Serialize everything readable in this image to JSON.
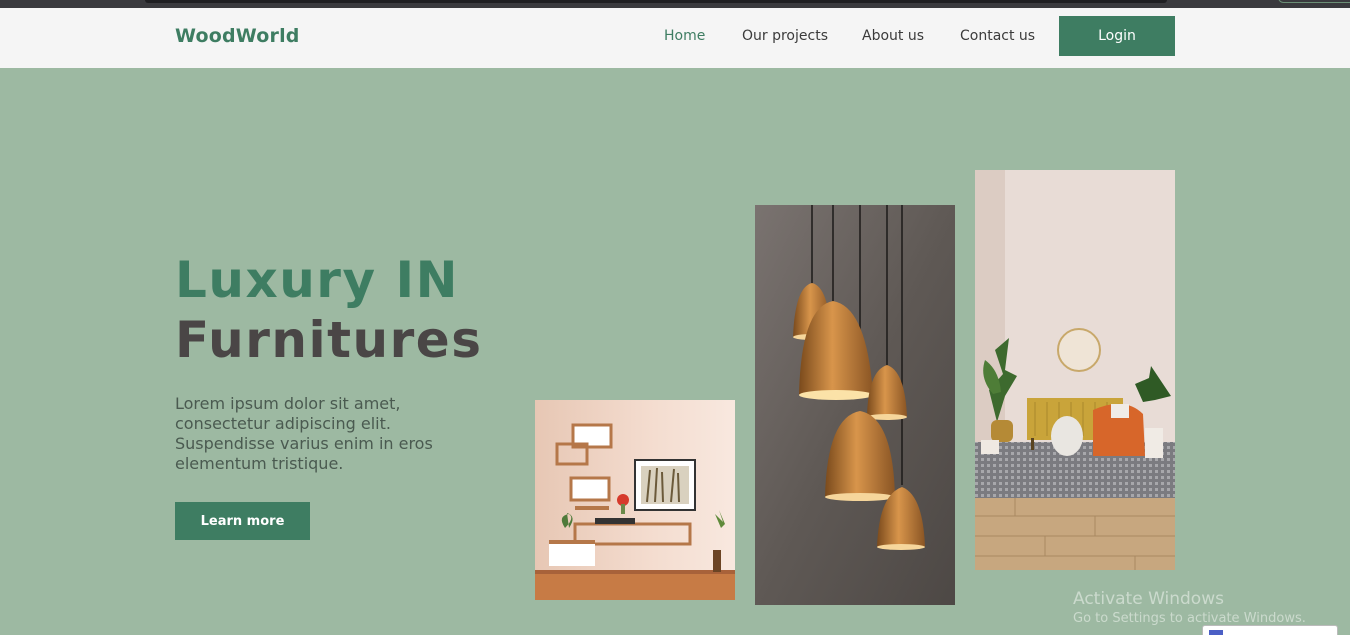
{
  "brand": {
    "logo": "WoodWorld",
    "accent": "#3e7d62",
    "background": "#9db9a2"
  },
  "nav": {
    "items": [
      "Home",
      "Our projects",
      "About us",
      "Contact us"
    ],
    "active": "Home",
    "login": "Login"
  },
  "hero": {
    "title_line1": "Luxury IN",
    "title_line2": "Furnitures",
    "description": "Lorem ipsum dolor sit amet, consectetur adipiscing elit. Suspendisse varius enim in eros elementum tristique.",
    "cta": "Learn more"
  },
  "gallery": [
    {
      "name": "wall-shelves-photo"
    },
    {
      "name": "pendant-lamps-photo"
    },
    {
      "name": "living-room-photo"
    }
  ],
  "os_overlay": {
    "line1": "Activate Windows",
    "line2": "Go to Settings to activate Windows."
  }
}
